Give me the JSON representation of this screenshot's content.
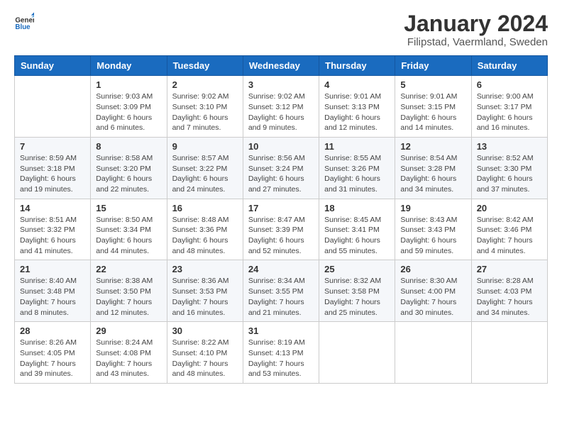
{
  "logo": {
    "general": "General",
    "blue": "Blue"
  },
  "header": {
    "title": "January 2024",
    "subtitle": "Filipstad, Vaermland, Sweden"
  },
  "weekdays": [
    "Sunday",
    "Monday",
    "Tuesday",
    "Wednesday",
    "Thursday",
    "Friday",
    "Saturday"
  ],
  "weeks": [
    [
      {
        "day": "",
        "info": ""
      },
      {
        "day": "1",
        "info": "Sunrise: 9:03 AM\nSunset: 3:09 PM\nDaylight: 6 hours\nand 6 minutes."
      },
      {
        "day": "2",
        "info": "Sunrise: 9:02 AM\nSunset: 3:10 PM\nDaylight: 6 hours\nand 7 minutes."
      },
      {
        "day": "3",
        "info": "Sunrise: 9:02 AM\nSunset: 3:12 PM\nDaylight: 6 hours\nand 9 minutes."
      },
      {
        "day": "4",
        "info": "Sunrise: 9:01 AM\nSunset: 3:13 PM\nDaylight: 6 hours\nand 12 minutes."
      },
      {
        "day": "5",
        "info": "Sunrise: 9:01 AM\nSunset: 3:15 PM\nDaylight: 6 hours\nand 14 minutes."
      },
      {
        "day": "6",
        "info": "Sunrise: 9:00 AM\nSunset: 3:17 PM\nDaylight: 6 hours\nand 16 minutes."
      }
    ],
    [
      {
        "day": "7",
        "info": "Sunrise: 8:59 AM\nSunset: 3:18 PM\nDaylight: 6 hours\nand 19 minutes."
      },
      {
        "day": "8",
        "info": "Sunrise: 8:58 AM\nSunset: 3:20 PM\nDaylight: 6 hours\nand 22 minutes."
      },
      {
        "day": "9",
        "info": "Sunrise: 8:57 AM\nSunset: 3:22 PM\nDaylight: 6 hours\nand 24 minutes."
      },
      {
        "day": "10",
        "info": "Sunrise: 8:56 AM\nSunset: 3:24 PM\nDaylight: 6 hours\nand 27 minutes."
      },
      {
        "day": "11",
        "info": "Sunrise: 8:55 AM\nSunset: 3:26 PM\nDaylight: 6 hours\nand 31 minutes."
      },
      {
        "day": "12",
        "info": "Sunrise: 8:54 AM\nSunset: 3:28 PM\nDaylight: 6 hours\nand 34 minutes."
      },
      {
        "day": "13",
        "info": "Sunrise: 8:52 AM\nSunset: 3:30 PM\nDaylight: 6 hours\nand 37 minutes."
      }
    ],
    [
      {
        "day": "14",
        "info": "Sunrise: 8:51 AM\nSunset: 3:32 PM\nDaylight: 6 hours\nand 41 minutes."
      },
      {
        "day": "15",
        "info": "Sunrise: 8:50 AM\nSunset: 3:34 PM\nDaylight: 6 hours\nand 44 minutes."
      },
      {
        "day": "16",
        "info": "Sunrise: 8:48 AM\nSunset: 3:36 PM\nDaylight: 6 hours\nand 48 minutes."
      },
      {
        "day": "17",
        "info": "Sunrise: 8:47 AM\nSunset: 3:39 PM\nDaylight: 6 hours\nand 52 minutes."
      },
      {
        "day": "18",
        "info": "Sunrise: 8:45 AM\nSunset: 3:41 PM\nDaylight: 6 hours\nand 55 minutes."
      },
      {
        "day": "19",
        "info": "Sunrise: 8:43 AM\nSunset: 3:43 PM\nDaylight: 6 hours\nand 59 minutes."
      },
      {
        "day": "20",
        "info": "Sunrise: 8:42 AM\nSunset: 3:46 PM\nDaylight: 7 hours\nand 4 minutes."
      }
    ],
    [
      {
        "day": "21",
        "info": "Sunrise: 8:40 AM\nSunset: 3:48 PM\nDaylight: 7 hours\nand 8 minutes."
      },
      {
        "day": "22",
        "info": "Sunrise: 8:38 AM\nSunset: 3:50 PM\nDaylight: 7 hours\nand 12 minutes."
      },
      {
        "day": "23",
        "info": "Sunrise: 8:36 AM\nSunset: 3:53 PM\nDaylight: 7 hours\nand 16 minutes."
      },
      {
        "day": "24",
        "info": "Sunrise: 8:34 AM\nSunset: 3:55 PM\nDaylight: 7 hours\nand 21 minutes."
      },
      {
        "day": "25",
        "info": "Sunrise: 8:32 AM\nSunset: 3:58 PM\nDaylight: 7 hours\nand 25 minutes."
      },
      {
        "day": "26",
        "info": "Sunrise: 8:30 AM\nSunset: 4:00 PM\nDaylight: 7 hours\nand 30 minutes."
      },
      {
        "day": "27",
        "info": "Sunrise: 8:28 AM\nSunset: 4:03 PM\nDaylight: 7 hours\nand 34 minutes."
      }
    ],
    [
      {
        "day": "28",
        "info": "Sunrise: 8:26 AM\nSunset: 4:05 PM\nDaylight: 7 hours\nand 39 minutes."
      },
      {
        "day": "29",
        "info": "Sunrise: 8:24 AM\nSunset: 4:08 PM\nDaylight: 7 hours\nand 43 minutes."
      },
      {
        "day": "30",
        "info": "Sunrise: 8:22 AM\nSunset: 4:10 PM\nDaylight: 7 hours\nand 48 minutes."
      },
      {
        "day": "31",
        "info": "Sunrise: 8:19 AM\nSunset: 4:13 PM\nDaylight: 7 hours\nand 53 minutes."
      },
      {
        "day": "",
        "info": ""
      },
      {
        "day": "",
        "info": ""
      },
      {
        "day": "",
        "info": ""
      }
    ]
  ]
}
